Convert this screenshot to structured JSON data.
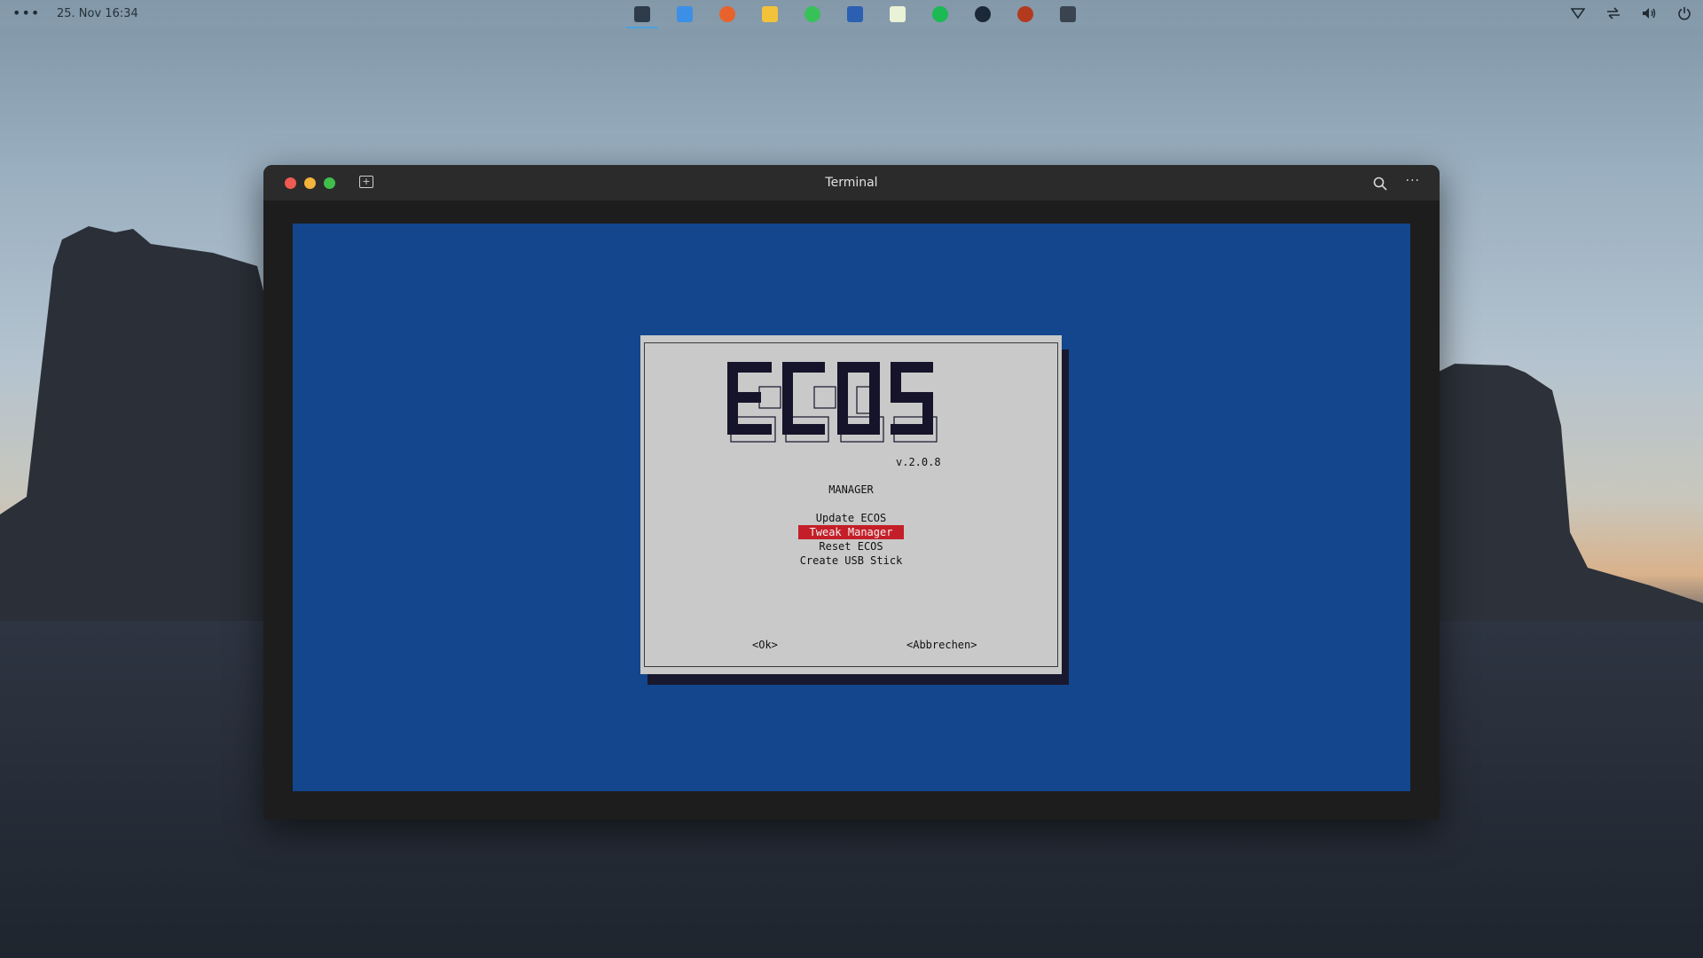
{
  "topbar": {
    "datetime": "25. Nov  16:34",
    "menu_icon": "dots-menu-icon",
    "dock": [
      {
        "name": "terminal-icon",
        "color": "#2d3b4a",
        "active": true
      },
      {
        "name": "files-icon",
        "color": "#3c8fe6"
      },
      {
        "name": "firefox-icon",
        "color": "#e8632c"
      },
      {
        "name": "mail-icon",
        "color": "#f3c23b"
      },
      {
        "name": "keepass-icon",
        "color": "#38c158"
      },
      {
        "name": "notes-book-icon",
        "color": "#2b5fb2"
      },
      {
        "name": "calendar-icon",
        "color": "#e9f2d6"
      },
      {
        "name": "spotify-icon",
        "color": "#1db954"
      },
      {
        "name": "steam-icon",
        "color": "#1b2838"
      },
      {
        "name": "media-pause-icon",
        "color": "#b33a1e"
      },
      {
        "name": "display-settings-icon",
        "color": "#394450"
      }
    ],
    "tray": [
      "wifi-icon",
      "network-transfer-icon",
      "volume-icon",
      "power-icon"
    ]
  },
  "window": {
    "title": "Terminal"
  },
  "dialog": {
    "logo_text": "ECOS",
    "version": "v.2.0.8",
    "heading": "MANAGER",
    "menu": [
      {
        "label": "Update ECOS",
        "selected": false
      },
      {
        "label": "Tweak Manager",
        "selected": true
      },
      {
        "label": "Reset ECOS",
        "selected": false
      },
      {
        "label": "Create USB Stick",
        "selected": false
      }
    ],
    "ok_label": "<Ok>",
    "cancel_label": "<Abbrechen>"
  },
  "colors": {
    "terminal_bg": "#13468d",
    "dialog_bg": "#c9c9c9",
    "selection": "#c41f28"
  }
}
